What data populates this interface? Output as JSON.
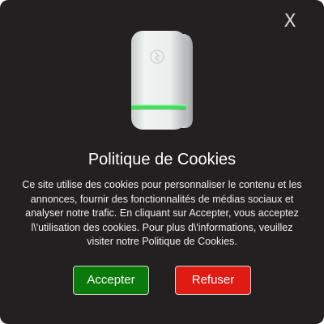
{
  "dialog": {
    "close_label": "X",
    "title": "Politique de Cookies",
    "message": "Ce site utilise des cookies pour personnaliser le contenu et les annonces, fournir des fonctionnalités de médias sociaux et analyser notre trafic. En cliquant sur Accepter, vous acceptez l\\'utilisation des cookies. Pour plus d\\'informations, veuillez visiter notre Politique de Cookies.",
    "accept_label": "Accepter",
    "refuse_label": "Refuser"
  },
  "colors": {
    "background": "#222020",
    "accept": "#0a7a0a",
    "refuse": "#e01b14",
    "device_led": "#2fd84a"
  },
  "icons": {
    "product": "power-saver-plug-device-image",
    "close": "close-icon"
  }
}
